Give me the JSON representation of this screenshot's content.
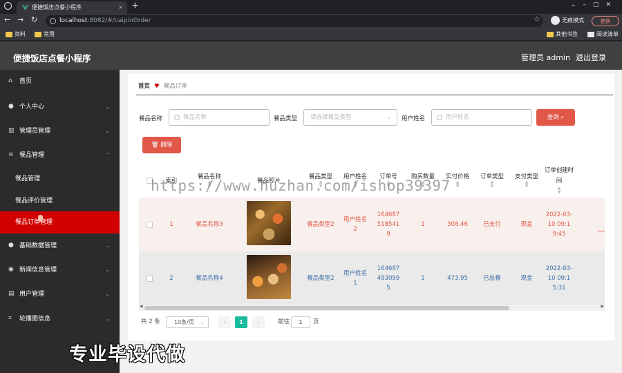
{
  "browser": {
    "tab_title": "便捷饭店点餐小程序",
    "tab_close": "×",
    "new_tab": "+",
    "url_host": "localhost",
    "url_path": ":8082/#/caipinOrder",
    "incognito_label": "无痕模式",
    "update_label": "更新",
    "bookmarks": [
      "资料",
      "常用"
    ],
    "bookmarks_right": [
      "其他书签",
      "阅读清单"
    ]
  },
  "header": {
    "app_title": "便捷饭店点餐小程序",
    "admin_label": "管理员 admin",
    "logout_label": "退出登录"
  },
  "sidebar": {
    "items": [
      {
        "label": "首页",
        "icon": "home-icon"
      },
      {
        "label": "个人中心",
        "icon": "person-icon"
      },
      {
        "label": "管理员管理",
        "icon": "chart-icon"
      },
      {
        "label": "餐品管理",
        "icon": "menu-icon"
      },
      {
        "label": "基础数据管理",
        "icon": "person-icon"
      },
      {
        "label": "新闻信息管理",
        "icon": "pin-icon"
      },
      {
        "label": "用户管理",
        "icon": "clipboard-icon"
      },
      {
        "label": "轮播图信息",
        "icon": "crop-icon"
      }
    ],
    "submenu": [
      "餐品管理",
      "餐品评价管理",
      "餐品订单管理"
    ]
  },
  "breadcrumb": {
    "home": "首页",
    "current": "餐品订单"
  },
  "filters": {
    "name_label": "餐品名称",
    "name_placeholder": "餐品名称",
    "type_label": "餐品类型",
    "type_placeholder": "请选择餐品类型",
    "user_label": "用户姓名",
    "user_placeholder": "用户姓名",
    "query_label": "查询",
    "delete_label": "删除"
  },
  "table": {
    "headers": [
      "索引",
      "餐品名称",
      "餐品照片",
      "餐品类型",
      "用户姓名",
      "订单号",
      "购买数量",
      "实付价格",
      "订单类型",
      "支付类型",
      "订单创建时间"
    ],
    "rows": [
      {
        "index": "1",
        "name": "餐品名称3",
        "type": "餐品类型2",
        "user": "用户姓名2",
        "order_no": "1646875185419",
        "qty": "1",
        "price": "308.46",
        "order_type": "已支付",
        "pay_type": "现金",
        "created": "2022-03-10 09:19:45"
      },
      {
        "index": "2",
        "name": "餐品名称4",
        "type": "餐品类型2",
        "user": "用户姓名1",
        "order_no": "1646874930995",
        "qty": "1",
        "price": "473.95",
        "order_type": "已出餐",
        "pay_type": "现金",
        "created": "2022-03-10 09:15:31"
      }
    ]
  },
  "pagination": {
    "total": "共 2 条",
    "page_size": "10条/页",
    "current_page": "1",
    "goto_label": "前往",
    "goto_value": "1",
    "page_unit": "页"
  },
  "watermark": "https://www.huzhan.com/ishop39397",
  "caption": "专业毕设代做"
}
